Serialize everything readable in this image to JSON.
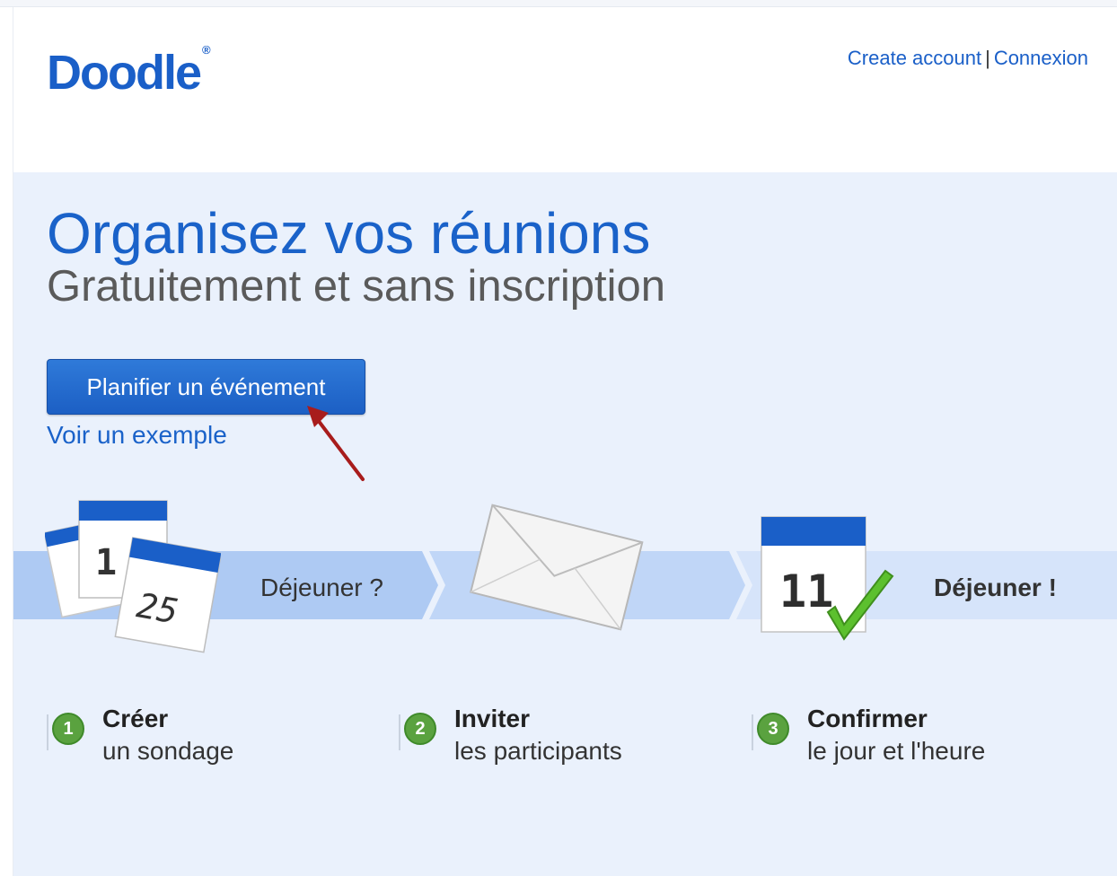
{
  "header": {
    "logo": "Doodle",
    "logo_mark": "®",
    "links": {
      "create_account": "Create account",
      "separator": "|",
      "login": "Connexion"
    }
  },
  "hero": {
    "title": "Organisez vos réunions",
    "subtitle": "Gratuitement et sans inscription",
    "cta_label": "Planifier un événement",
    "example_link": "Voir un exemple"
  },
  "process": {
    "calendar_numbers": [
      "1",
      "25",
      "11"
    ],
    "question_label": "Déjeuner ?",
    "result_label": "Déjeuner !"
  },
  "steps": [
    {
      "number": "1",
      "title": "Créer",
      "subtitle": "un sondage"
    },
    {
      "number": "2",
      "title": "Inviter",
      "subtitle": "les participants"
    },
    {
      "number": "3",
      "title": "Confirmer",
      "subtitle": "le jour et l'heure"
    }
  ],
  "colors": {
    "brand_blue": "#1a5fc8",
    "hero_background": "#eaf1fc",
    "band_blue": "#b7cff5",
    "step_green": "#5aa23f",
    "arrow_red": "#a81c1c",
    "check_green": "#5cc02e"
  },
  "icons": [
    "calendar-stack-icon",
    "envelope-icon",
    "calendar-check-icon",
    "red-arrow-icon"
  ]
}
